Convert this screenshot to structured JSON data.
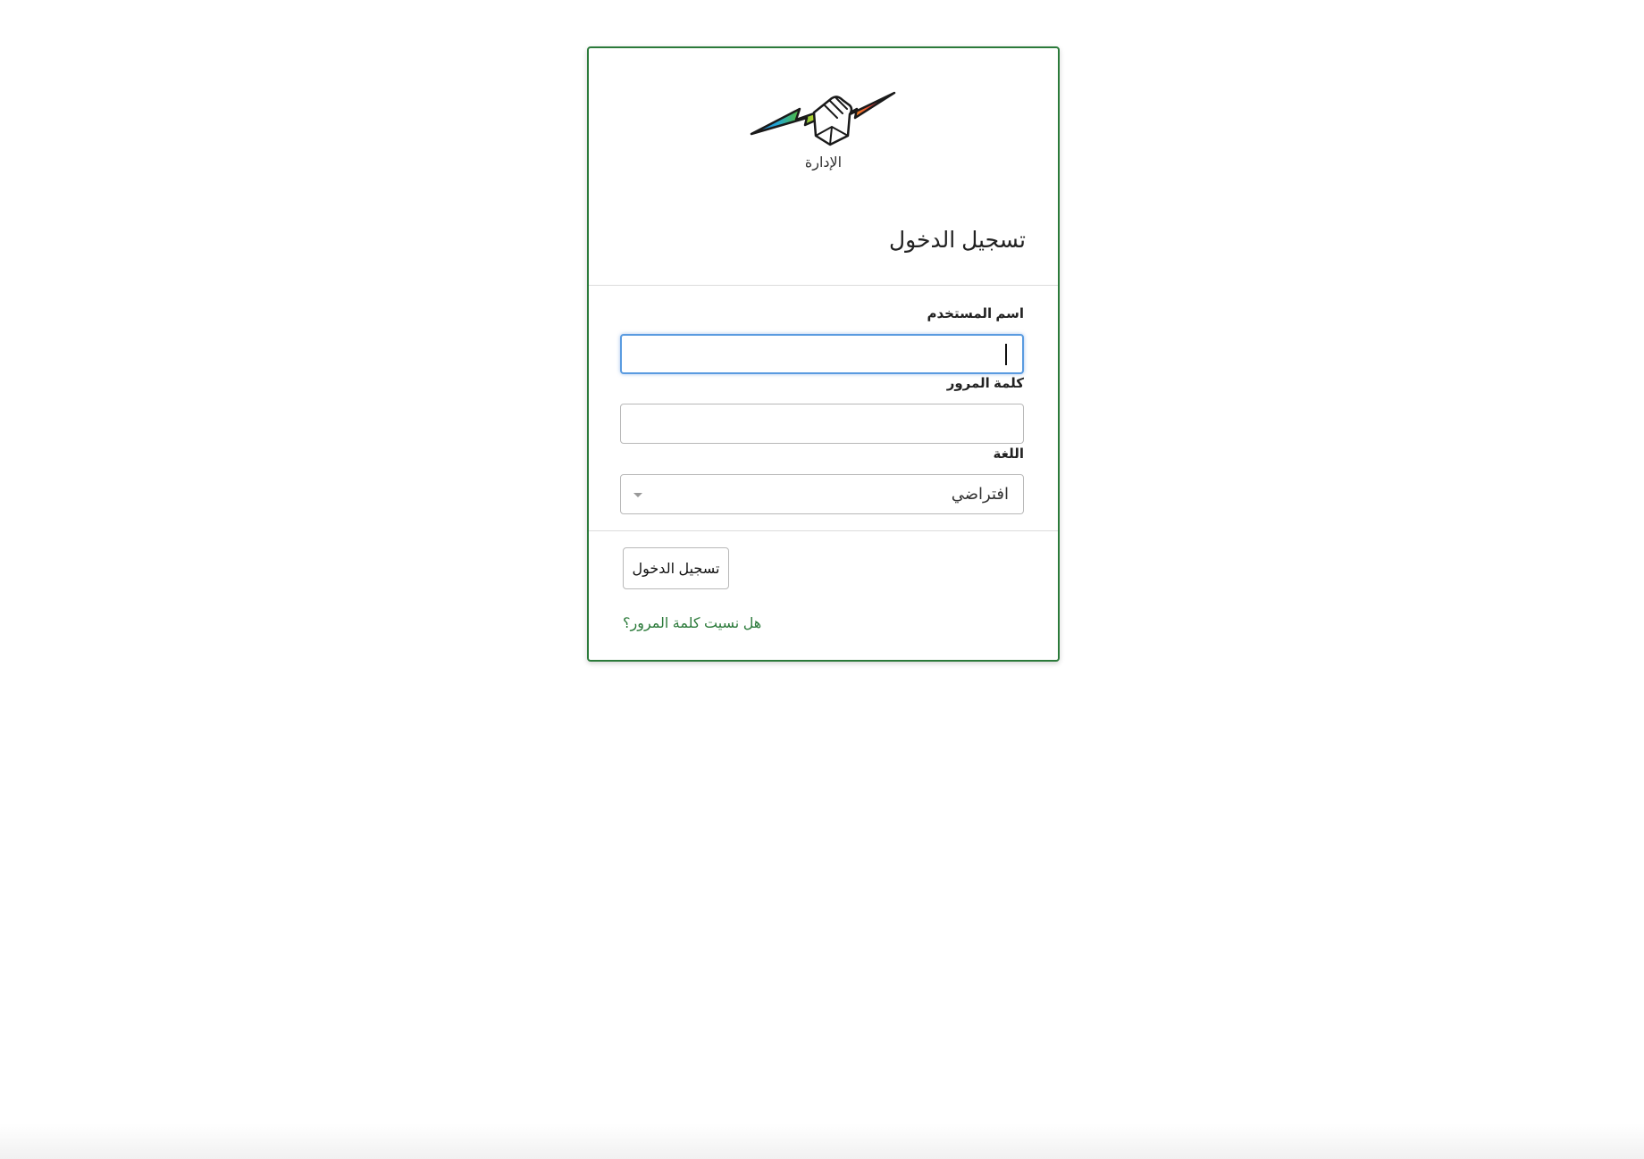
{
  "colors": {
    "accent": "#2b7a3a",
    "focus": "#5a9be0"
  },
  "logo": {
    "icon": "lightning-hand-logo-icon",
    "caption": "الإدارة"
  },
  "card": {
    "title": "تسجيل الدخول"
  },
  "form": {
    "username": {
      "label": "اسم المستخدم",
      "value": "",
      "focused": true
    },
    "password": {
      "label": "كلمة المرور",
      "value": ""
    },
    "language": {
      "label": "اللغة",
      "selected": "افتراضي",
      "icon": "chevron-down-icon"
    },
    "submit_label": "تسجيل الدخول",
    "forgot_label": "هل نسيت كلمة المرور؟"
  }
}
